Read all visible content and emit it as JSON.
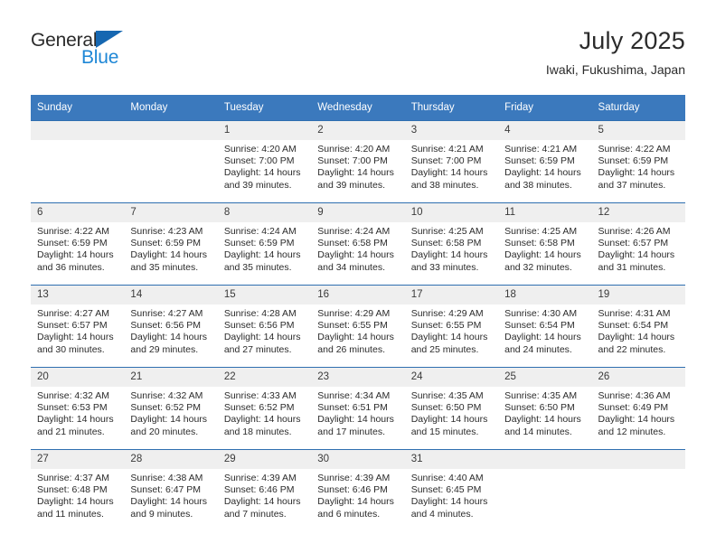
{
  "brand": {
    "name_part1": "General",
    "name_part2": "Blue",
    "triangle_icon": "triangle-icon",
    "color_dark": "#2b2b2b",
    "color_blue": "#1e87d6",
    "color_triangle": "#1667b1"
  },
  "header": {
    "title": "July 2025",
    "subtitle": "Iwaki, Fukushima, Japan"
  },
  "theme": {
    "header_blue": "#3b79bd",
    "row_rule_blue": "#2f6fb0",
    "daynum_band": "#efefef",
    "text": "#2b2b2b"
  },
  "weekday_headers": [
    "Sunday",
    "Monday",
    "Tuesday",
    "Wednesday",
    "Thursday",
    "Friday",
    "Saturday"
  ],
  "weeks": [
    [
      {
        "day": "",
        "sunrise": "",
        "sunset": "",
        "daylight1": "",
        "daylight2": ""
      },
      {
        "day": "",
        "sunrise": "",
        "sunset": "",
        "daylight1": "",
        "daylight2": ""
      },
      {
        "day": "1",
        "sunrise": "Sunrise: 4:20 AM",
        "sunset": "Sunset: 7:00 PM",
        "daylight1": "Daylight: 14 hours",
        "daylight2": "and 39 minutes."
      },
      {
        "day": "2",
        "sunrise": "Sunrise: 4:20 AM",
        "sunset": "Sunset: 7:00 PM",
        "daylight1": "Daylight: 14 hours",
        "daylight2": "and 39 minutes."
      },
      {
        "day": "3",
        "sunrise": "Sunrise: 4:21 AM",
        "sunset": "Sunset: 7:00 PM",
        "daylight1": "Daylight: 14 hours",
        "daylight2": "and 38 minutes."
      },
      {
        "day": "4",
        "sunrise": "Sunrise: 4:21 AM",
        "sunset": "Sunset: 6:59 PM",
        "daylight1": "Daylight: 14 hours",
        "daylight2": "and 38 minutes."
      },
      {
        "day": "5",
        "sunrise": "Sunrise: 4:22 AM",
        "sunset": "Sunset: 6:59 PM",
        "daylight1": "Daylight: 14 hours",
        "daylight2": "and 37 minutes."
      }
    ],
    [
      {
        "day": "6",
        "sunrise": "Sunrise: 4:22 AM",
        "sunset": "Sunset: 6:59 PM",
        "daylight1": "Daylight: 14 hours",
        "daylight2": "and 36 minutes."
      },
      {
        "day": "7",
        "sunrise": "Sunrise: 4:23 AM",
        "sunset": "Sunset: 6:59 PM",
        "daylight1": "Daylight: 14 hours",
        "daylight2": "and 35 minutes."
      },
      {
        "day": "8",
        "sunrise": "Sunrise: 4:24 AM",
        "sunset": "Sunset: 6:59 PM",
        "daylight1": "Daylight: 14 hours",
        "daylight2": "and 35 minutes."
      },
      {
        "day": "9",
        "sunrise": "Sunrise: 4:24 AM",
        "sunset": "Sunset: 6:58 PM",
        "daylight1": "Daylight: 14 hours",
        "daylight2": "and 34 minutes."
      },
      {
        "day": "10",
        "sunrise": "Sunrise: 4:25 AM",
        "sunset": "Sunset: 6:58 PM",
        "daylight1": "Daylight: 14 hours",
        "daylight2": "and 33 minutes."
      },
      {
        "day": "11",
        "sunrise": "Sunrise: 4:25 AM",
        "sunset": "Sunset: 6:58 PM",
        "daylight1": "Daylight: 14 hours",
        "daylight2": "and 32 minutes."
      },
      {
        "day": "12",
        "sunrise": "Sunrise: 4:26 AM",
        "sunset": "Sunset: 6:57 PM",
        "daylight1": "Daylight: 14 hours",
        "daylight2": "and 31 minutes."
      }
    ],
    [
      {
        "day": "13",
        "sunrise": "Sunrise: 4:27 AM",
        "sunset": "Sunset: 6:57 PM",
        "daylight1": "Daylight: 14 hours",
        "daylight2": "and 30 minutes."
      },
      {
        "day": "14",
        "sunrise": "Sunrise: 4:27 AM",
        "sunset": "Sunset: 6:56 PM",
        "daylight1": "Daylight: 14 hours",
        "daylight2": "and 29 minutes."
      },
      {
        "day": "15",
        "sunrise": "Sunrise: 4:28 AM",
        "sunset": "Sunset: 6:56 PM",
        "daylight1": "Daylight: 14 hours",
        "daylight2": "and 27 minutes."
      },
      {
        "day": "16",
        "sunrise": "Sunrise: 4:29 AM",
        "sunset": "Sunset: 6:55 PM",
        "daylight1": "Daylight: 14 hours",
        "daylight2": "and 26 minutes."
      },
      {
        "day": "17",
        "sunrise": "Sunrise: 4:29 AM",
        "sunset": "Sunset: 6:55 PM",
        "daylight1": "Daylight: 14 hours",
        "daylight2": "and 25 minutes."
      },
      {
        "day": "18",
        "sunrise": "Sunrise: 4:30 AM",
        "sunset": "Sunset: 6:54 PM",
        "daylight1": "Daylight: 14 hours",
        "daylight2": "and 24 minutes."
      },
      {
        "day": "19",
        "sunrise": "Sunrise: 4:31 AM",
        "sunset": "Sunset: 6:54 PM",
        "daylight1": "Daylight: 14 hours",
        "daylight2": "and 22 minutes."
      }
    ],
    [
      {
        "day": "20",
        "sunrise": "Sunrise: 4:32 AM",
        "sunset": "Sunset: 6:53 PM",
        "daylight1": "Daylight: 14 hours",
        "daylight2": "and 21 minutes."
      },
      {
        "day": "21",
        "sunrise": "Sunrise: 4:32 AM",
        "sunset": "Sunset: 6:52 PM",
        "daylight1": "Daylight: 14 hours",
        "daylight2": "and 20 minutes."
      },
      {
        "day": "22",
        "sunrise": "Sunrise: 4:33 AM",
        "sunset": "Sunset: 6:52 PM",
        "daylight1": "Daylight: 14 hours",
        "daylight2": "and 18 minutes."
      },
      {
        "day": "23",
        "sunrise": "Sunrise: 4:34 AM",
        "sunset": "Sunset: 6:51 PM",
        "daylight1": "Daylight: 14 hours",
        "daylight2": "and 17 minutes."
      },
      {
        "day": "24",
        "sunrise": "Sunrise: 4:35 AM",
        "sunset": "Sunset: 6:50 PM",
        "daylight1": "Daylight: 14 hours",
        "daylight2": "and 15 minutes."
      },
      {
        "day": "25",
        "sunrise": "Sunrise: 4:35 AM",
        "sunset": "Sunset: 6:50 PM",
        "daylight1": "Daylight: 14 hours",
        "daylight2": "and 14 minutes."
      },
      {
        "day": "26",
        "sunrise": "Sunrise: 4:36 AM",
        "sunset": "Sunset: 6:49 PM",
        "daylight1": "Daylight: 14 hours",
        "daylight2": "and 12 minutes."
      }
    ],
    [
      {
        "day": "27",
        "sunrise": "Sunrise: 4:37 AM",
        "sunset": "Sunset: 6:48 PM",
        "daylight1": "Daylight: 14 hours",
        "daylight2": "and 11 minutes."
      },
      {
        "day": "28",
        "sunrise": "Sunrise: 4:38 AM",
        "sunset": "Sunset: 6:47 PM",
        "daylight1": "Daylight: 14 hours",
        "daylight2": "and 9 minutes."
      },
      {
        "day": "29",
        "sunrise": "Sunrise: 4:39 AM",
        "sunset": "Sunset: 6:46 PM",
        "daylight1": "Daylight: 14 hours",
        "daylight2": "and 7 minutes."
      },
      {
        "day": "30",
        "sunrise": "Sunrise: 4:39 AM",
        "sunset": "Sunset: 6:46 PM",
        "daylight1": "Daylight: 14 hours",
        "daylight2": "and 6 minutes."
      },
      {
        "day": "31",
        "sunrise": "Sunrise: 4:40 AM",
        "sunset": "Sunset: 6:45 PM",
        "daylight1": "Daylight: 14 hours",
        "daylight2": "and 4 minutes."
      },
      {
        "day": "",
        "sunrise": "",
        "sunset": "",
        "daylight1": "",
        "daylight2": ""
      },
      {
        "day": "",
        "sunrise": "",
        "sunset": "",
        "daylight1": "",
        "daylight2": ""
      }
    ]
  ]
}
